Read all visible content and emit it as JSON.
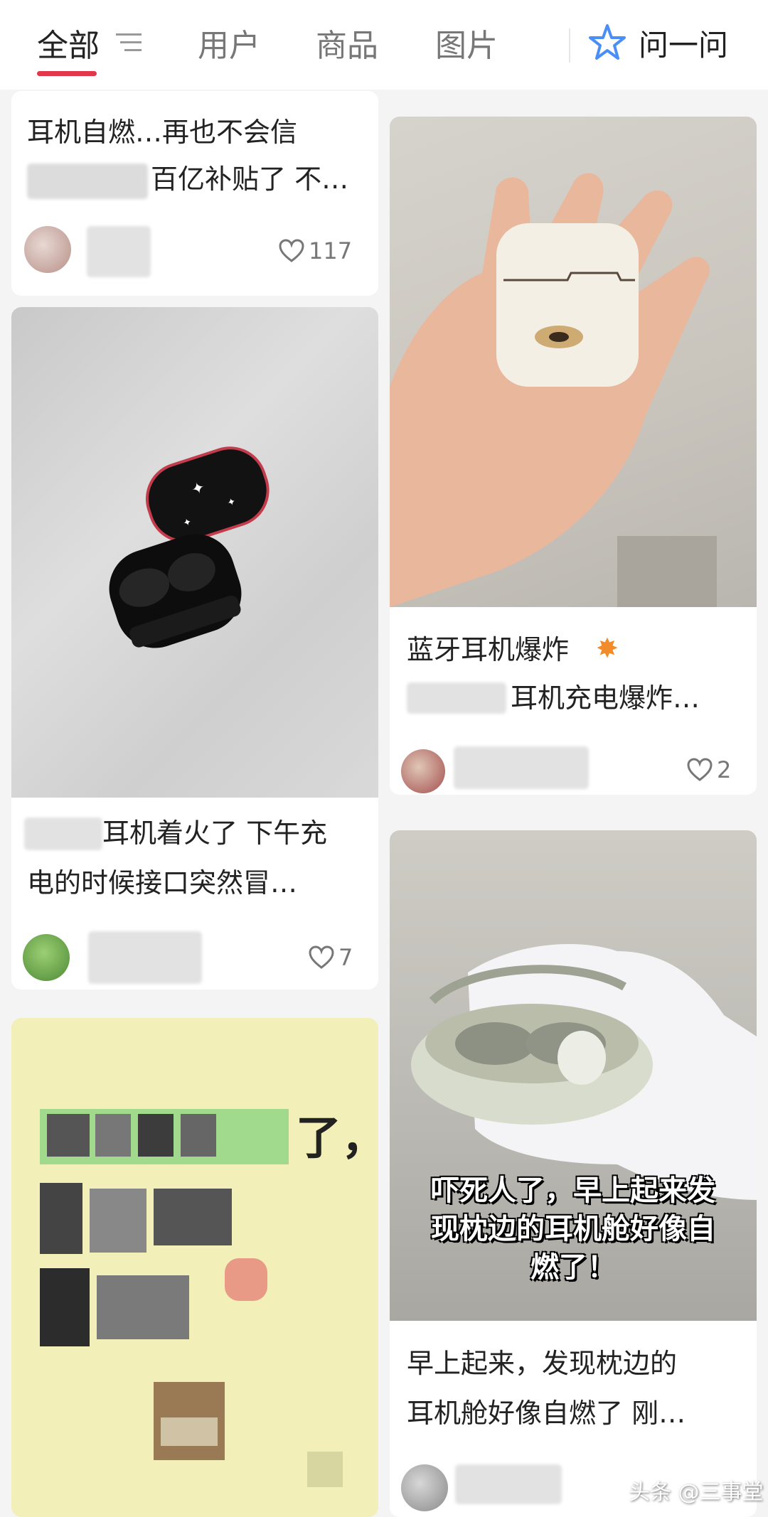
{
  "tabs": [
    {
      "label": "全部"
    },
    {
      "label": "用户"
    },
    {
      "label": "商品"
    },
    {
      "label": "图片"
    }
  ],
  "ask": {
    "label": "问一问"
  },
  "colors": {
    "accent": "#e2374a",
    "text": "#222222",
    "muted": "#777777"
  },
  "cards": [
    {
      "title_lines": [
        "耳机自燃…再也不会信",
        "百亿补贴了 不…"
      ],
      "likes": "117"
    },
    {
      "title_lines": [
        "蓝牙耳机爆炸",
        "耳机充电爆炸…"
      ],
      "likes": "2"
    },
    {
      "title_lines": [
        "耳机着火了 下午充",
        "电的时候接口突然冒…"
      ],
      "likes": "7"
    },
    {
      "title_lines": [
        "早上起来，发现枕边的",
        "耳机舱好像自燃了 刚…"
      ],
      "overlay_lines": [
        "吓死人了，早上起来发",
        "现枕边的耳机舱好像自",
        "燃了！"
      ]
    }
  ],
  "card5": {
    "text_lines": [
      "了，"
    ]
  },
  "watermark": "头条 @三事堂"
}
